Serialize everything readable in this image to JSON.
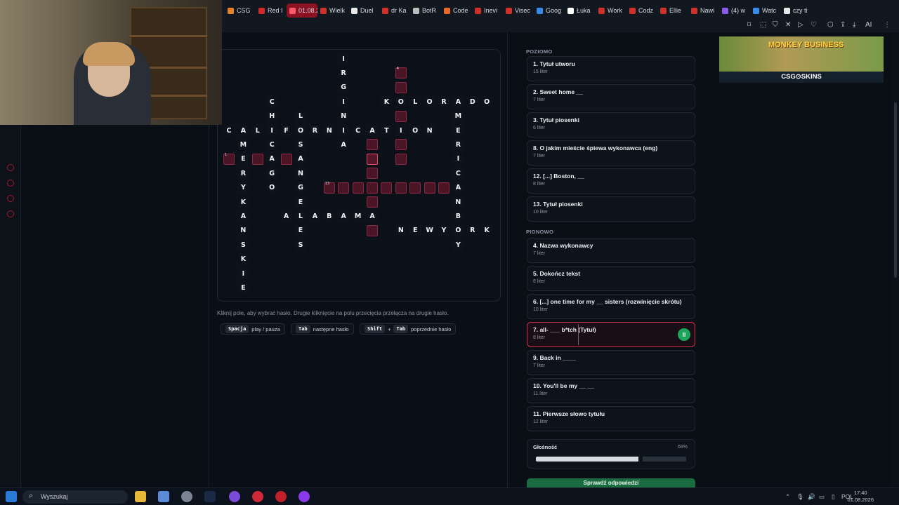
{
  "tabs": [
    {
      "label": "CSG",
      "color": "#e8822a"
    },
    {
      "label": "Red I",
      "color": "#d02a2a"
    },
    {
      "label": "01.08.2",
      "color": "#ff5a6a"
    },
    {
      "label": "Wielk",
      "color": "#d0302a"
    },
    {
      "label": "Duel",
      "color": "#e8e8e8"
    },
    {
      "label": "dr Ka",
      "color": "#d0302a"
    },
    {
      "label": "BotR",
      "color": "#bbbbbb"
    },
    {
      "label": "Code",
      "color": "#e86a2a"
    },
    {
      "label": "Inevi",
      "color": "#d0302a"
    },
    {
      "label": "Visec",
      "color": "#d0302a"
    },
    {
      "label": "Goog",
      "color": "#3a8ae8"
    },
    {
      "label": "Łuka",
      "color": "#ffffff"
    },
    {
      "label": "Work",
      "color": "#d0302a"
    },
    {
      "label": "Codz",
      "color": "#d0302a"
    },
    {
      "label": "Ellie",
      "color": "#d0302a"
    },
    {
      "label": "Nawi",
      "color": "#d0302a"
    },
    {
      "label": "(4) w",
      "color": "#8a5ae8"
    },
    {
      "label": "Watc",
      "color": "#3a8ae8"
    },
    {
      "label": "czy ti",
      "color": "#e8e8e8"
    }
  ],
  "grid": {
    "cells": [
      {
        "r": 0,
        "c": 8,
        "v": "I"
      },
      {
        "r": 1,
        "c": 8,
        "v": "R"
      },
      {
        "r": 2,
        "c": 8,
        "v": "G"
      },
      {
        "r": 3,
        "c": 8,
        "v": "I"
      },
      {
        "r": 4,
        "c": 8,
        "v": "N"
      },
      {
        "r": 6,
        "c": 8,
        "v": "A"
      },
      {
        "r": 1,
        "c": 12,
        "v": "",
        "n": "4"
      },
      {
        "r": 2,
        "c": 12,
        "v": ""
      },
      {
        "r": 3,
        "c": 11,
        "v": "K"
      },
      {
        "r": 3,
        "c": 12,
        "v": "O"
      },
      {
        "r": 3,
        "c": 13,
        "v": "L"
      },
      {
        "r": 3,
        "c": 14,
        "v": "O"
      },
      {
        "r": 3,
        "c": 15,
        "v": "R"
      },
      {
        "r": 3,
        "c": 16,
        "v": "A"
      },
      {
        "r": 3,
        "c": 17,
        "v": "D"
      },
      {
        "r": 3,
        "c": 18,
        "v": "O"
      },
      {
        "r": 4,
        "c": 12,
        "v": ""
      },
      {
        "r": 6,
        "c": 12,
        "v": ""
      },
      {
        "r": 7,
        "c": 12,
        "v": ""
      },
      {
        "r": 3,
        "c": 3,
        "v": "C"
      },
      {
        "r": 4,
        "c": 3,
        "v": "H"
      },
      {
        "r": 6,
        "c": 3,
        "v": "C"
      },
      {
        "r": 7,
        "c": 3,
        "v": "A"
      },
      {
        "r": 8,
        "c": 3,
        "v": "G"
      },
      {
        "r": 9,
        "c": 3,
        "v": "O"
      },
      {
        "r": 4,
        "c": 5,
        "v": "L"
      },
      {
        "r": 6,
        "c": 5,
        "v": "S"
      },
      {
        "r": 7,
        "c": 5,
        "v": "A"
      },
      {
        "r": 8,
        "c": 5,
        "v": "N"
      },
      {
        "r": 9,
        "c": 5,
        "v": "G"
      },
      {
        "r": 10,
        "c": 5,
        "v": "E"
      },
      {
        "r": 12,
        "c": 5,
        "v": "E"
      },
      {
        "r": 13,
        "c": 5,
        "v": "S"
      },
      {
        "r": 5,
        "c": 0,
        "v": "C"
      },
      {
        "r": 5,
        "c": 1,
        "v": "A"
      },
      {
        "r": 5,
        "c": 2,
        "v": "L"
      },
      {
        "r": 5,
        "c": 3,
        "v": "I"
      },
      {
        "r": 5,
        "c": 4,
        "v": "F"
      },
      {
        "r": 5,
        "c": 5,
        "v": "O"
      },
      {
        "r": 5,
        "c": 6,
        "v": "R"
      },
      {
        "r": 5,
        "c": 7,
        "v": "N"
      },
      {
        "r": 5,
        "c": 8,
        "v": "I"
      },
      {
        "r": 5,
        "c": 9,
        "v": "C"
      },
      {
        "r": 5,
        "c": 10,
        "v": "A"
      },
      {
        "r": 5,
        "c": 11,
        "v": "T"
      },
      {
        "r": 5,
        "c": 12,
        "v": "I"
      },
      {
        "r": 5,
        "c": 13,
        "v": "O"
      },
      {
        "r": 5,
        "c": 14,
        "v": "N"
      },
      {
        "r": 4,
        "c": 16,
        "v": "M"
      },
      {
        "r": 5,
        "c": 16,
        "v": "E"
      },
      {
        "r": 6,
        "c": 16,
        "v": "R"
      },
      {
        "r": 7,
        "c": 16,
        "v": "I"
      },
      {
        "r": 8,
        "c": 16,
        "v": "C"
      },
      {
        "r": 9,
        "c": 16,
        "v": "A"
      },
      {
        "r": 10,
        "c": 16,
        "v": "N"
      },
      {
        "r": 11,
        "c": 16,
        "v": "B"
      },
      {
        "r": 12,
        "c": 16,
        "v": "O"
      },
      {
        "r": 13,
        "c": 16,
        "v": "Y"
      },
      {
        "r": 6,
        "c": 1,
        "v": "M"
      },
      {
        "r": 7,
        "c": 1,
        "v": "E"
      },
      {
        "r": 8,
        "c": 1,
        "v": "R"
      },
      {
        "r": 9,
        "c": 1,
        "v": "Y"
      },
      {
        "r": 10,
        "c": 1,
        "v": "K"
      },
      {
        "r": 11,
        "c": 1,
        "v": "A"
      },
      {
        "r": 12,
        "c": 1,
        "v": "N"
      },
      {
        "r": 13,
        "c": 1,
        "v": "S"
      },
      {
        "r": 14,
        "c": 1,
        "v": "K"
      },
      {
        "r": 15,
        "c": 1,
        "v": "I"
      },
      {
        "r": 16,
        "c": 1,
        "v": "E"
      },
      {
        "r": 7,
        "c": 0,
        "v": "",
        "n": "1"
      },
      {
        "r": 7,
        "c": 2,
        "v": ""
      },
      {
        "r": 7,
        "c": 4,
        "v": ""
      },
      {
        "r": 6,
        "c": 10,
        "v": ""
      },
      {
        "r": 7,
        "c": 10,
        "v": "",
        "hi": true
      },
      {
        "r": 8,
        "c": 10,
        "v": ""
      },
      {
        "r": 9,
        "c": 7,
        "v": "",
        "n": "13"
      },
      {
        "r": 9,
        "c": 8,
        "v": ""
      },
      {
        "r": 9,
        "c": 9,
        "v": ""
      },
      {
        "r": 9,
        "c": 10,
        "v": ""
      },
      {
        "r": 9,
        "c": 11,
        "v": ""
      },
      {
        "r": 9,
        "c": 12,
        "v": ""
      },
      {
        "r": 9,
        "c": 13,
        "v": ""
      },
      {
        "r": 9,
        "c": 14,
        "v": ""
      },
      {
        "r": 9,
        "c": 15,
        "v": ""
      },
      {
        "r": 10,
        "c": 10,
        "v": ""
      },
      {
        "r": 11,
        "c": 4,
        "v": "A"
      },
      {
        "r": 11,
        "c": 5,
        "v": "L"
      },
      {
        "r": 11,
        "c": 6,
        "v": "A"
      },
      {
        "r": 11,
        "c": 7,
        "v": "B"
      },
      {
        "r": 11,
        "c": 8,
        "v": "A"
      },
      {
        "r": 11,
        "c": 9,
        "v": "M"
      },
      {
        "r": 11,
        "c": 10,
        "v": "A"
      },
      {
        "r": 12,
        "c": 10,
        "v": ""
      },
      {
        "r": 12,
        "c": 12,
        "v": "N"
      },
      {
        "r": 12,
        "c": 13,
        "v": "E"
      },
      {
        "r": 12,
        "c": 14,
        "v": "W"
      },
      {
        "r": 12,
        "c": 15,
        "v": "Y"
      },
      {
        "r": 12,
        "c": 17,
        "v": "R"
      },
      {
        "r": 12,
        "c": 18,
        "v": "K"
      }
    ]
  },
  "hint": "Kliknij pole, aby wybrać hasło. Drugie kliknięcie na polu przecięcia przełącza na drugie hasło.",
  "shortcuts": {
    "space_key": "Spacja",
    "space_label": "play / pauza",
    "tab_key": "Tab",
    "tab_label": "następne hasło",
    "shift_key": "Shift",
    "plus": "+",
    "shift_tab_key": "Tab",
    "shift_tab_label": "poprzednie hasło"
  },
  "clues": {
    "across_title": "POZIOMO",
    "across": [
      {
        "text": "1. Tytuł utworu",
        "sub": "15 liter"
      },
      {
        "text": "2. Sweet home __",
        "sub": "7 liter"
      },
      {
        "text": "3. Tytuł piosenki",
        "sub": "6 liter"
      },
      {
        "text": "8. O jakim mieście śpiewa wykonawca (eng)",
        "sub": "7 liter"
      },
      {
        "text": "12. [...] Boston, __",
        "sub": "8 liter"
      },
      {
        "text": "13. Tytuł piosenki",
        "sub": "10 liter"
      }
    ],
    "down_title": "PIONOWO",
    "down": [
      {
        "text": "4. Nazwa wykonawcy",
        "sub": "7 liter"
      },
      {
        "text": "5. Dokończ tekst",
        "sub": "8 liter"
      },
      {
        "text": "6. [...] one time for my __ sisters (rozwinięcie skrótu)",
        "sub": "10 liter"
      },
      {
        "text": "7. all- ___ b*tch (Tytuł)",
        "sub": "8 liter",
        "active": true
      },
      {
        "text": "9. Back in ____",
        "sub": "7 liter"
      },
      {
        "text": "10. You'll be my __ __",
        "sub": "11 liter"
      },
      {
        "text": "11. Pierwsze słowo tytułu",
        "sub": "12 liter"
      }
    ]
  },
  "pause_icon": "II",
  "volume": {
    "label": "Głośność",
    "percent_text": "68%",
    "value": 0.68
  },
  "check_button": "Sprawdź odpowiedzi",
  "ad": {
    "title": "MONKEY BUSINESS",
    "brand": "CSG⊙SKINS"
  },
  "taskbar": {
    "search_placeholder": "Wyszukaj",
    "lang": "POL",
    "time": "17:40",
    "date": "01.08.2026"
  }
}
